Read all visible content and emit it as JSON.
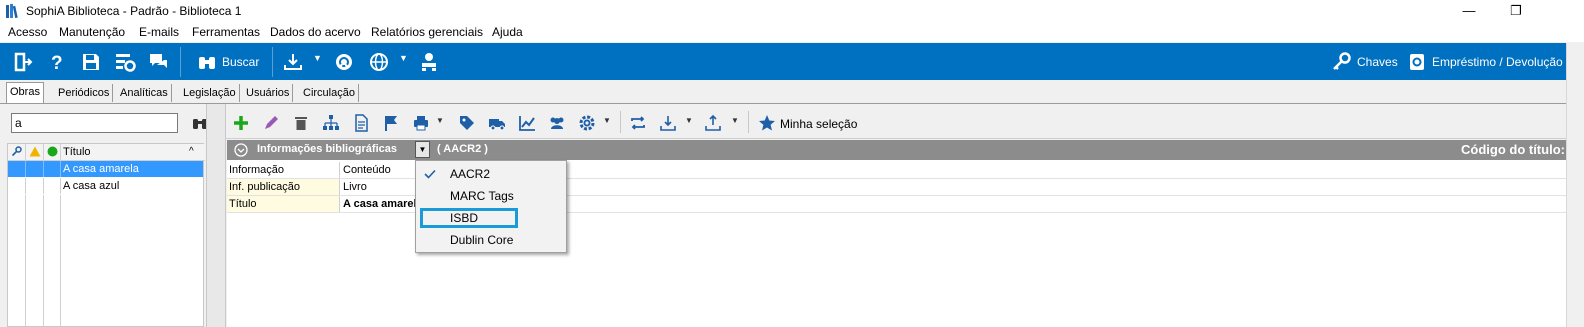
{
  "window": {
    "title": "SophiA Biblioteca - Padrão - Biblioteca 1",
    "controls": [
      "—",
      "❐"
    ]
  },
  "menubar": [
    "Acesso",
    "Manutenção",
    "E-mails",
    "Ferramentas",
    "Dados do acervo",
    "Relatórios gerenciais",
    "Ajuda"
  ],
  "toolbar": {
    "search_label": "Buscar",
    "keys_label": "Chaves",
    "loan_label": "Empréstimo / Devolução"
  },
  "tabs": [
    "Obras",
    "Periódicos",
    "Analíticas",
    "Legislação",
    "Usuários",
    "Circulação"
  ],
  "left_panel": {
    "search_value": "a",
    "column_header": "Título",
    "items": [
      "A casa amarela",
      "A casa azul"
    ]
  },
  "right_toolbar": {
    "my_selection_label": "Minha seleção"
  },
  "info_header": {
    "label": "Informações bibliográficas",
    "format": "( AACR2 )",
    "code_label": "Código do título:"
  },
  "table": {
    "columns": [
      "Informação",
      "Conteúdo"
    ],
    "rows": [
      {
        "info": "Inf. publicação",
        "content": "Livro"
      },
      {
        "info": "Título",
        "content": "A casa amarela"
      }
    ]
  },
  "dropdown": {
    "items": [
      "AACR2",
      "MARC Tags",
      "ISBD",
      "Dublin Core"
    ],
    "checked": "AACR2",
    "highlighted": "ISBD"
  },
  "colors": {
    "toolbar_blue": "#0070c0",
    "selection_blue": "#3399ff",
    "highlight_border": "#1a9ad6",
    "info_header_gray": "#8c8c8c"
  }
}
